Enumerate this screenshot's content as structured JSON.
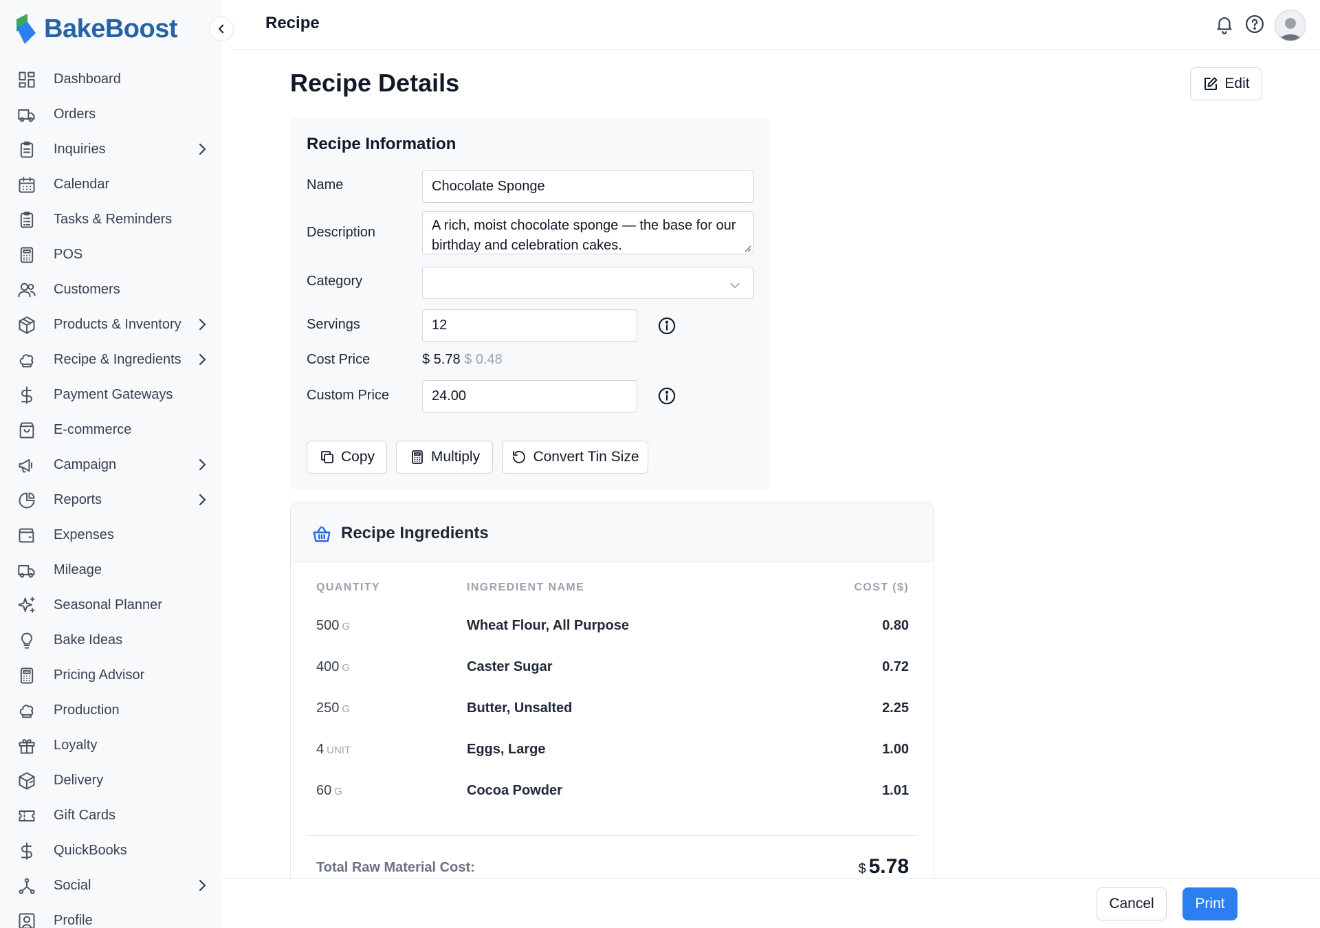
{
  "brand": {
    "name": "BakeBoost",
    "accent": "#2563a6",
    "logo_colors": [
      "#3aa856",
      "#2b7ff0"
    ]
  },
  "sidebar": {
    "items": [
      {
        "id": "dashboard",
        "label": "Dashboard",
        "icon": "grid-icon",
        "chevron": false
      },
      {
        "id": "orders",
        "label": "Orders",
        "icon": "truck-icon",
        "chevron": false
      },
      {
        "id": "inquiries",
        "label": "Inquiries",
        "icon": "clipboard-icon",
        "chevron": true
      },
      {
        "id": "calendar",
        "label": "Calendar",
        "icon": "calendar-icon",
        "chevron": false
      },
      {
        "id": "tasks",
        "label": "Tasks & Reminders",
        "icon": "clipboard-list-icon",
        "chevron": false
      },
      {
        "id": "pos",
        "label": "POS",
        "icon": "calculator-icon",
        "chevron": false
      },
      {
        "id": "customers",
        "label": "Customers",
        "icon": "users-icon",
        "chevron": false
      },
      {
        "id": "products",
        "label": "Products & Inventory",
        "icon": "box-icon",
        "chevron": true
      },
      {
        "id": "recipes",
        "label": "Recipe & Ingredients",
        "icon": "chef-hat-icon",
        "chevron": true
      },
      {
        "id": "payments",
        "label": "Payment Gateways",
        "icon": "dollar-icon",
        "chevron": false
      },
      {
        "id": "ecommerce",
        "label": "E-commerce",
        "icon": "shopping-bag-icon",
        "chevron": false
      },
      {
        "id": "campaign",
        "label": "Campaign",
        "icon": "megaphone-icon",
        "chevron": true
      },
      {
        "id": "reports",
        "label": "Reports",
        "icon": "pie-chart-icon",
        "chevron": true
      },
      {
        "id": "expenses",
        "label": "Expenses",
        "icon": "wallet-icon",
        "chevron": false
      },
      {
        "id": "mileage",
        "label": "Mileage",
        "icon": "truck-icon",
        "chevron": false
      },
      {
        "id": "seasonal",
        "label": "Seasonal Planner",
        "icon": "sparkles-icon",
        "chevron": false
      },
      {
        "id": "ideas",
        "label": "Bake Ideas",
        "icon": "lightbulb-icon",
        "chevron": false
      },
      {
        "id": "pricing",
        "label": "Pricing Advisor",
        "icon": "calculator-icon",
        "chevron": false
      },
      {
        "id": "production",
        "label": "Production",
        "icon": "chef-hat-icon",
        "chevron": false
      },
      {
        "id": "loyalty",
        "label": "Loyalty",
        "icon": "gift-icon",
        "chevron": false
      },
      {
        "id": "delivery",
        "label": "Delivery",
        "icon": "package-icon",
        "chevron": false
      },
      {
        "id": "giftcards",
        "label": "Gift Cards",
        "icon": "ticket-icon",
        "chevron": false
      },
      {
        "id": "quickbooks",
        "label": "QuickBooks",
        "icon": "dollar-icon",
        "chevron": false
      },
      {
        "id": "social",
        "label": "Social",
        "icon": "share-network-icon",
        "chevron": true
      },
      {
        "id": "profile",
        "label": "Profile",
        "icon": "user-square-icon",
        "chevron": false
      }
    ]
  },
  "header": {
    "title": "Recipe"
  },
  "page": {
    "title": "Recipe Details",
    "edit_label": "Edit"
  },
  "recipe_info": {
    "title": "Recipe Information",
    "name_label": "Name",
    "name_value": "Chocolate Sponge",
    "description_label": "Description",
    "description_value": "A rich, moist chocolate sponge — the base for our birthday and celebration cakes.",
    "category_label": "Category",
    "category_value": "",
    "servings_label": "Servings",
    "servings_value": "12",
    "cost_price_label": "Cost Price",
    "cost_price_value": "$ 5.78",
    "cost_per_serving": "$ 0.48",
    "custom_price_label": "Custom Price",
    "custom_price_value": "24.00",
    "buttons": {
      "copy": "Copy",
      "multiply": "Multiply",
      "convert": "Convert Tin Size"
    }
  },
  "ingredients": {
    "title": "Recipe Ingredients",
    "columns": {
      "quantity": "QUANTITY",
      "name": "INGREDIENT NAME",
      "cost": "COST ($)"
    },
    "rows": [
      {
        "qty": "500",
        "unit": "g",
        "name": "Wheat Flour, All Purpose",
        "cost": "0.80"
      },
      {
        "qty": "400",
        "unit": "g",
        "name": "Caster Sugar",
        "cost": "0.72"
      },
      {
        "qty": "250",
        "unit": "g",
        "name": "Butter, Unsalted",
        "cost": "2.25"
      },
      {
        "qty": "4",
        "unit": "unit",
        "name": "Eggs, Large",
        "cost": "1.00"
      },
      {
        "qty": "60",
        "unit": "g",
        "name": "Cocoa Powder",
        "cost": "1.01"
      }
    ],
    "total_label": "Total Raw Material Cost:",
    "total_currency": "$",
    "total_value": "5.78"
  },
  "footer": {
    "cancel_label": "Cancel",
    "print_label": "Print",
    "print_color": "#2b7ff0"
  }
}
